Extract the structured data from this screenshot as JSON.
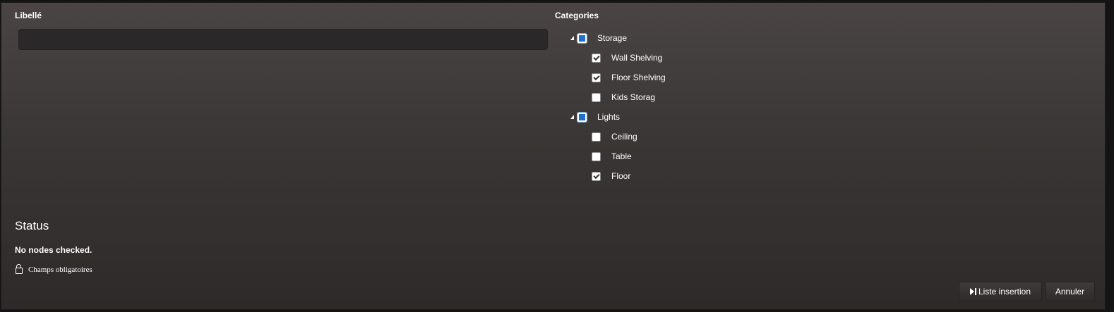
{
  "form": {
    "libelle_label": "Libellé",
    "libelle_value": "",
    "categories_label": "Categories"
  },
  "tree": {
    "groups": [
      {
        "label": "Storage",
        "state": "partial",
        "expanded": true,
        "items": [
          {
            "label": "Wall Shelving",
            "checked": true
          },
          {
            "label": "Floor Shelving",
            "checked": true
          },
          {
            "label": "Kids Storag",
            "checked": false
          }
        ]
      },
      {
        "label": "Lights",
        "state": "partial",
        "expanded": true,
        "items": [
          {
            "label": "Ceiling",
            "checked": false
          },
          {
            "label": "Table",
            "checked": false
          },
          {
            "label": "Floor",
            "checked": true
          }
        ]
      }
    ]
  },
  "status": {
    "title": "Status",
    "message": "No nodes checked."
  },
  "footer": {
    "required_label": "Champs obligatoires",
    "insert_button": "Liste insertion",
    "cancel_button": "Annuler"
  },
  "colors": {
    "partial_fill": "#1f6fd0",
    "panel_top": "#4a4544",
    "panel_bottom": "#2d2a29"
  }
}
